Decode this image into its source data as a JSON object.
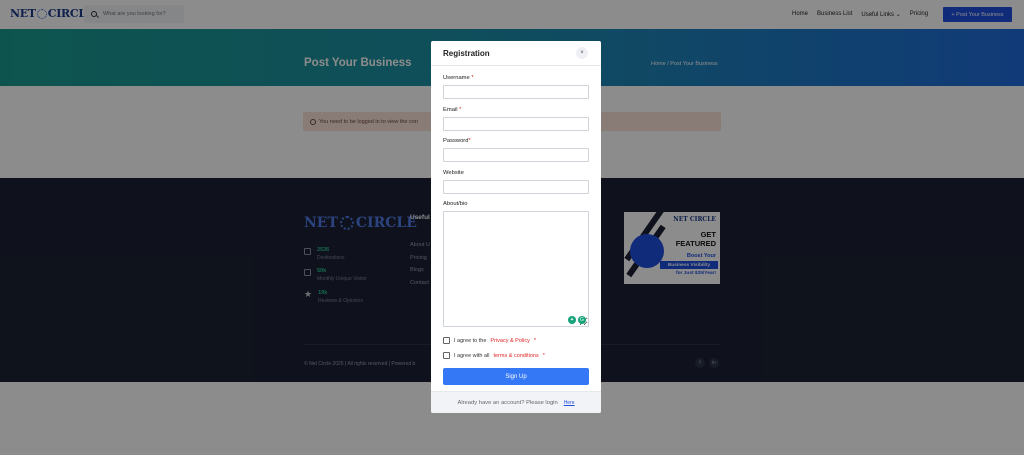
{
  "header": {
    "logo_left": "NET",
    "logo_right": "CIRCLE",
    "search_placeholder": "What are you looking for?",
    "nav": [
      "Home",
      "Business List",
      "Useful Links",
      "Pricing"
    ],
    "post_button": "+ Post Your Business"
  },
  "hero": {
    "title": "Post Your Business",
    "breadcrumb": "Home  /  Post Your Business"
  },
  "alert": {
    "text": "You need to be logged in to view the con"
  },
  "footer": {
    "logo_left": "NET",
    "logo_right": "CIRCLE",
    "stats": [
      {
        "num": "2536",
        "label": "Destinations"
      },
      {
        "num": "50k",
        "label": "Monthly Unique Visitor"
      },
      {
        "num": "19k",
        "label": "Reviews & Opinions"
      }
    ],
    "useful_heading": "Useful",
    "useful_links": [
      "About U",
      "Pricing",
      "Blogs",
      "Contact"
    ],
    "ad": {
      "logo": "NET CIRCLE",
      "headline_1": "GET",
      "headline_2": "FEATURED",
      "boost": "Boost Your",
      "bar": "Business Visibility",
      "price": "for Just $25/Year!"
    },
    "copyright": "© Net Circle 2025 | All rights reserved | Powered b",
    "social": [
      "f",
      "in"
    ]
  },
  "modal": {
    "title": "Registration",
    "close_icon": "×",
    "username_label": "Username",
    "email_label": "Email",
    "password_label": "Password",
    "website_label": "Website",
    "about_label": "About/bio",
    "required_mark": "*",
    "agree_privacy_prefix": "I agree to the",
    "agree_privacy_link": "Privacy & Policy",
    "agree_terms_prefix": "I agree with all",
    "agree_terms_link": "terms & conditions",
    "signup_button": "Sign Up",
    "footer_text": "Already have an account? Please login",
    "footer_link": "Here"
  }
}
